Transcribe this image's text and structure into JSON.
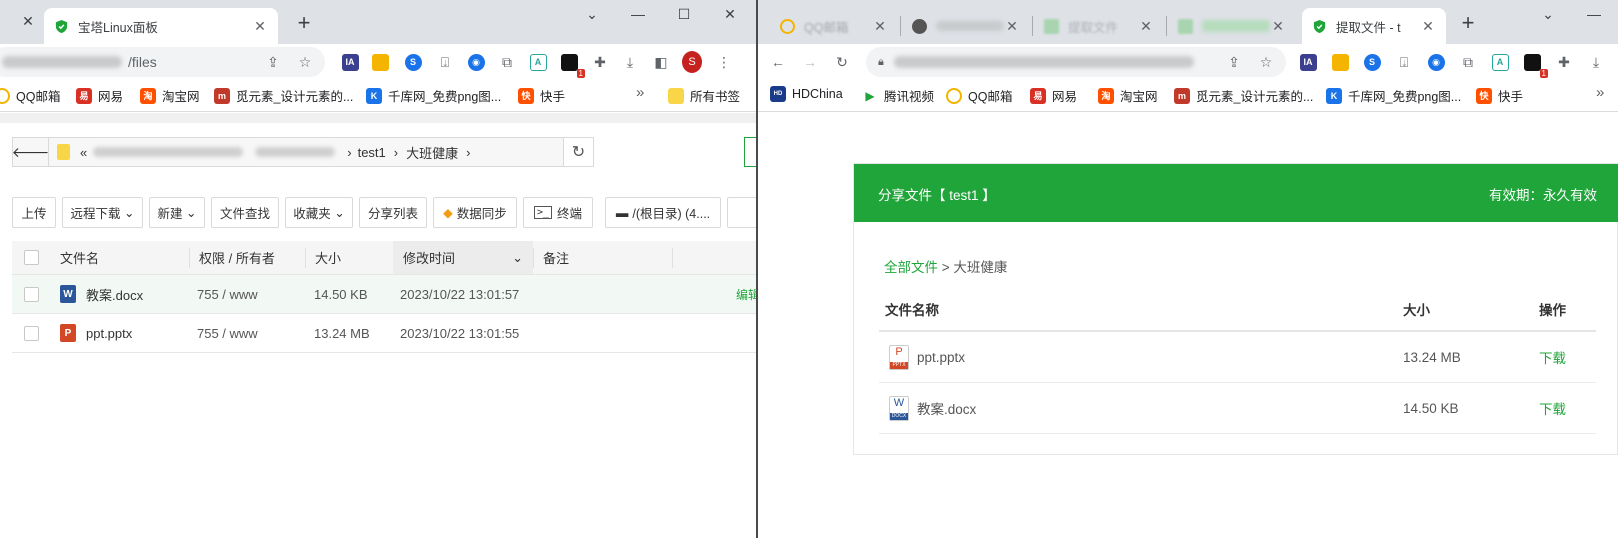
{
  "left_window": {
    "tabs": [
      {
        "title": "宝塔Linux面板",
        "active": true
      }
    ],
    "address": "/files",
    "bookmarks": [
      "QQ邮箱",
      "网易",
      "淘宝网",
      "觅元素_设计元素的...",
      "千库网_免费png图...",
      "快手",
      "所有书签"
    ],
    "profile_initial": "S",
    "ext_badge": "1",
    "ext_ia_label": "IA",
    "path": {
      "segments": [
        "test1",
        "大班健康"
      ]
    },
    "toolbar_buttons": [
      "上传",
      "远程下载",
      "新建",
      "文件查找",
      "收藏夹",
      "分享列表",
      "数据同步",
      "终端",
      "/(根目录) (4...."
    ],
    "table": {
      "headers": [
        "文件名",
        "权限 / 所有者",
        "大小",
        "修改时间",
        "备注"
      ],
      "rows": [
        {
          "name": "教案.docx",
          "perm": "755 / www",
          "size": "14.50 KB",
          "mtime": "2023/10/22 13:01:57",
          "action": "编辑",
          "type": "word"
        },
        {
          "name": "ppt.pptx",
          "perm": "755 / www",
          "size": "13.24 MB",
          "mtime": "2023/10/22 13:01:55",
          "action": "",
          "type": "ppt"
        }
      ]
    }
  },
  "right_window": {
    "tabs": [
      {
        "title": "QQ邮箱",
        "active": false
      },
      {
        "title": "",
        "active": false
      },
      {
        "title": "提取文件",
        "active": false
      },
      {
        "title": "",
        "active": false
      },
      {
        "title": "提取文件 - t",
        "active": true
      }
    ],
    "bookmarks": [
      "HDChina",
      "腾讯视频",
      "QQ邮箱",
      "网易",
      "淘宝网",
      "觅元素_设计元素的...",
      "千库网_免费png图...",
      "快手"
    ],
    "ext_badge": "1",
    "ext_ia_label": "IA",
    "share": {
      "title": "分享文件【 test1 】",
      "validity": "有效期：永久有效",
      "crumb_root": "全部文件",
      "crumb_sep": ">",
      "crumb_current": "大班健康",
      "headers": [
        "文件名称",
        "大小",
        "操作"
      ],
      "files": [
        {
          "name": "ppt.pptx",
          "size": "13.24 MB",
          "action": "下载",
          "type": "ppt"
        },
        {
          "name": "教案.docx",
          "size": "14.50 KB",
          "action": "下载",
          "type": "word"
        }
      ]
    }
  },
  "colors": {
    "accent": "#20a53a",
    "tabstrip": "#dee1e6"
  }
}
